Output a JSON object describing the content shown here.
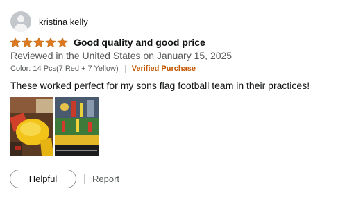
{
  "review": {
    "reviewer_name": "kristina kelly",
    "rating": 5,
    "rating_color": "#de7921",
    "title": "Good quality and good price",
    "date_line": "Reviewed in the United States on January 15, 2025",
    "variant": "Color: 14 Pcs(7 Red + 7 Yellow)",
    "verified_label": "Verified Purchase",
    "verified_color": "#c45500",
    "body": "These worked perfect for my sons flag football team in their practices!",
    "images": [
      {
        "icon": "photo-flags-yellow"
      },
      {
        "icon": "photo-football-belts-box",
        "caption": "ag Football Belts"
      }
    ],
    "actions": {
      "helpful_label": "Helpful",
      "report_label": "Report"
    }
  }
}
